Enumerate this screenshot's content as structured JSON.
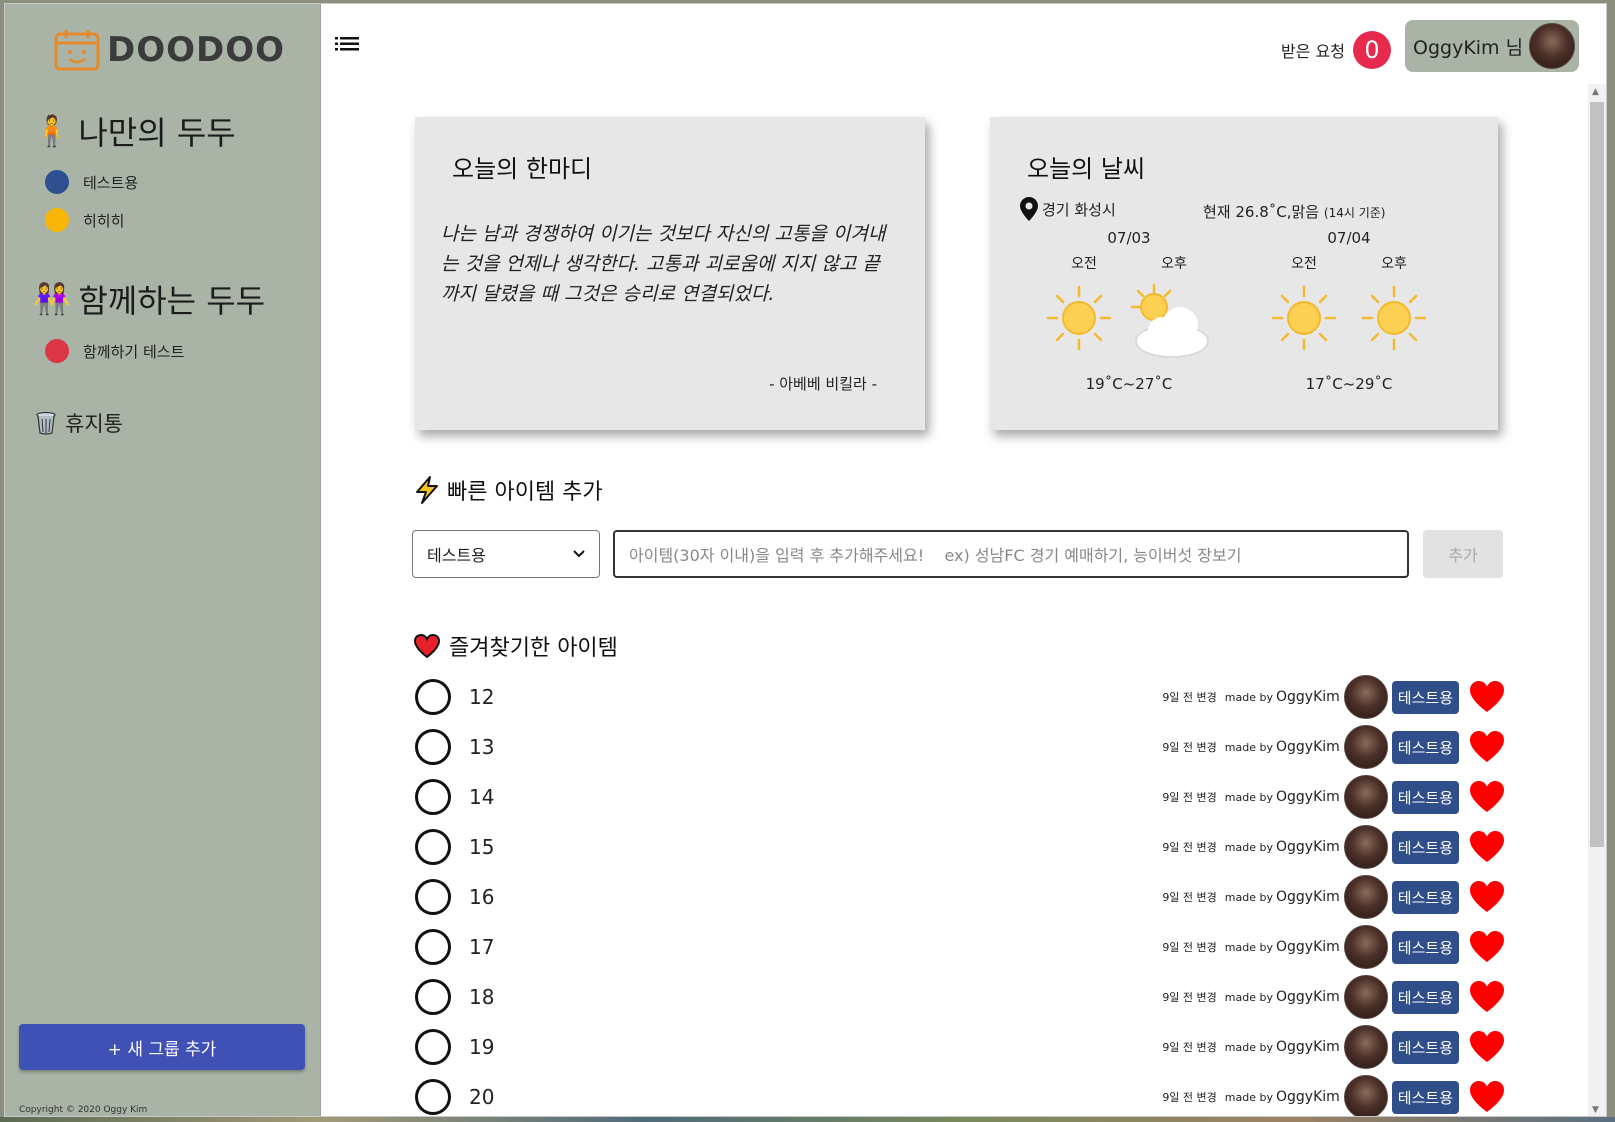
{
  "sidebar": {
    "logo_text": "DOODOO",
    "my_section": {
      "title": "나만의 두두",
      "emoji": "🧍"
    },
    "my_groups": [
      {
        "label": "테스트용",
        "color": "#2e5090"
      },
      {
        "label": "히히히",
        "color": "#f9b608"
      }
    ],
    "shared_section": {
      "title": "함께하는 두두",
      "emoji": "👭"
    },
    "shared_groups": [
      {
        "label": "함께하기 테스트",
        "color": "#dc3545"
      }
    ],
    "trash_label": "휴지통",
    "add_group_label": "+ 새 그룹 추가",
    "copyright": "Copyright © 2020 Oggy Kim"
  },
  "header": {
    "requests_label": "받은 요청",
    "requests_count": "0",
    "user_label": "OggyKim 님"
  },
  "quote_card": {
    "title": "오늘의 한마디",
    "text": "나는 남과 경쟁하여 이기는 것보다 자신의 고통을 이겨내는 것을 언제나 생각한다. 고통과 괴로움에 지지 않고 끝까지 달렸을 때 그것은 승리로 연결되었다.",
    "author": "- 아베베 비킬라 -"
  },
  "weather_card": {
    "title": "오늘의 날씨",
    "location": "경기 화성시",
    "current": "현재 26.8˚C,맑음",
    "current_note": "(14시 기준)",
    "days": [
      {
        "date": "07/03",
        "am_label": "오전",
        "pm_label": "오후",
        "am_icon": "sun-icon",
        "pm_icon": "partly-cloudy-icon",
        "temp": "19˚C~27˚C"
      },
      {
        "date": "07/04",
        "am_label": "오전",
        "pm_label": "오후",
        "am_icon": "sun-icon",
        "pm_icon": "sun-icon",
        "temp": "17˚C~29˚C"
      }
    ]
  },
  "quick_add": {
    "title": "빠른 아이템 추가",
    "selected_group": "테스트용",
    "placeholder": "아이템(30자 이내)을 입력 후 추가해주세요!    ex) 성남FC 경기 예매하기, 능이버섯 장보기",
    "add_label": "추가"
  },
  "favorites": {
    "title": "즐겨찾기한 아이템",
    "items": [
      {
        "title": "12",
        "changed": "9일 전 변경",
        "made_by": "made by",
        "author": "OggyKim",
        "group": "테스트용"
      },
      {
        "title": "13",
        "changed": "9일 전 변경",
        "made_by": "made by",
        "author": "OggyKim",
        "group": "테스트용"
      },
      {
        "title": "14",
        "changed": "9일 전 변경",
        "made_by": "made by",
        "author": "OggyKim",
        "group": "테스트용"
      },
      {
        "title": "15",
        "changed": "9일 전 변경",
        "made_by": "made by",
        "author": "OggyKim",
        "group": "테스트용"
      },
      {
        "title": "16",
        "changed": "9일 전 변경",
        "made_by": "made by",
        "author": "OggyKim",
        "group": "테스트용"
      },
      {
        "title": "17",
        "changed": "9일 전 변경",
        "made_by": "made by",
        "author": "OggyKim",
        "group": "테스트용"
      },
      {
        "title": "18",
        "changed": "9일 전 변경",
        "made_by": "made by",
        "author": "OggyKim",
        "group": "테스트용"
      },
      {
        "title": "19",
        "changed": "9일 전 변경",
        "made_by": "made by",
        "author": "OggyKim",
        "group": "테스트용"
      },
      {
        "title": "20",
        "changed": "9일 전 변경",
        "made_by": "made by",
        "author": "OggyKim",
        "group": "테스트용"
      }
    ]
  },
  "colors": {
    "sidebar_bg": "#a9b4a6",
    "brand_blue": "#3f51b5",
    "tag_blue": "#304f8a",
    "badge_red": "#e8294e",
    "heart_red": "#ff0000"
  }
}
